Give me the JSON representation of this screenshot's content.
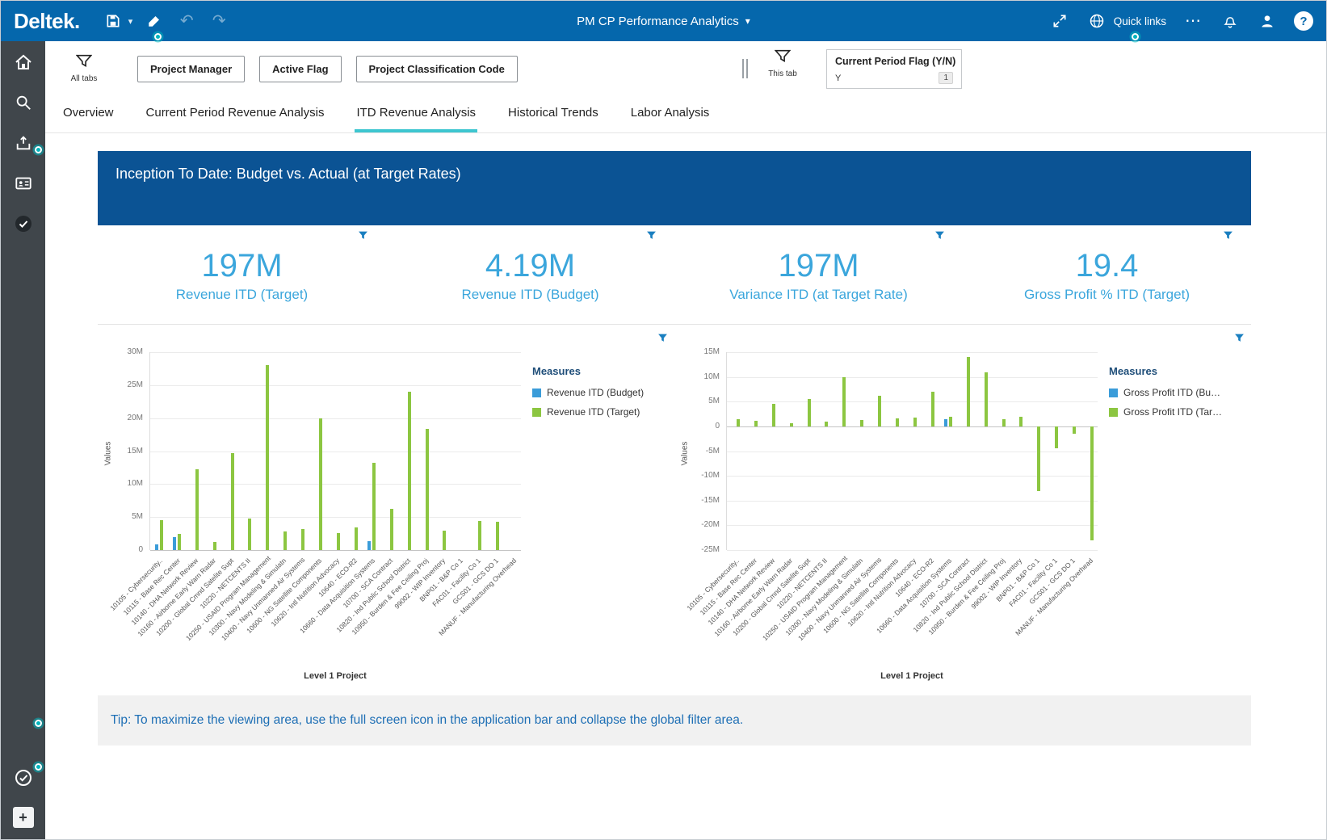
{
  "topbar": {
    "brand": "Deltek",
    "title": "PM CP Performance Analytics",
    "quick_links_label": "Quick links"
  },
  "icons": {
    "chevron_down": "▾",
    "undo": "↶",
    "redo": "↷",
    "ellipsis": "⋯",
    "help": "?",
    "plus": "+"
  },
  "filter_bar": {
    "all_tabs_label": "All tabs",
    "this_tab_label": "This tab",
    "filter_buttons": [
      {
        "label": "Project Manager"
      },
      {
        "label": "Active Flag"
      },
      {
        "label": "Project Classification Code"
      }
    ],
    "current_period_filter": {
      "title": "Current Period Flag (Y/N)",
      "value": "Y",
      "count": "1"
    }
  },
  "tabs": [
    {
      "label": "Overview",
      "active": false
    },
    {
      "label": "Current Period Revenue Analysis",
      "active": false
    },
    {
      "label": "ITD Revenue Analysis",
      "active": true
    },
    {
      "label": "Historical Trends",
      "active": false
    },
    {
      "label": "Labor Analysis",
      "active": false
    }
  ],
  "banner": {
    "title": "Inception To Date:  Budget vs. Actual (at Target Rates)"
  },
  "kpis": [
    {
      "value": "197M",
      "label": "Revenue ITD (Target)"
    },
    {
      "value": "4.19M",
      "label": "Revenue ITD (Budget)"
    },
    {
      "value": "197M",
      "label": "Variance ITD (at Target Rate)"
    },
    {
      "value": "19.4",
      "label": "Gross Profit % ITD (Target)"
    }
  ],
  "tip": {
    "text": "Tip:  To maximize the viewing area, use the full screen icon in the application bar and collapse the global filter area."
  },
  "colors": {
    "topbar_blue": "#0567AC",
    "banner_blue": "#0B5394",
    "kpi_blue": "#3BA6DC",
    "accent_teal": "#3EC6D0",
    "coachmark_teal": "#00B5BE",
    "bar_blue": "#3B9CD9",
    "bar_green": "#8CC641"
  },
  "chart_data": [
    {
      "type": "bar",
      "title": "",
      "xlabel": "Level 1 Project",
      "ylabel": "Values",
      "ylim": [
        0,
        30
      ],
      "yticks": [
        30,
        25,
        20,
        15,
        10,
        5,
        0
      ],
      "unit": "M",
      "grid": true,
      "legend_title": "Measures",
      "legend_position": "right",
      "categories": [
        "10105 - Cybersecurity..",
        "10115 - Base Rec Center",
        "10140 - DHA Network Review",
        "10160 - Airborne Early Warn Radar",
        "10200 - Global Cmnd Satelite Supt",
        "10220 - NETCENTS II",
        "10250 - USAID Program Management",
        "10300 - Navy Modeling & Simulatn",
        "10400 - Navy Unmanned Air Systems",
        "10600 - NG Satellite Components",
        "10620 - Intl Nutrition Advocacy",
        "10640 - ECO-R2",
        "10660 - Data Acquisition Systems",
        "10700 - SCA Contract",
        "10820 - Ind Public School District",
        "10950 - Burden & Fee Ceiling Proj",
        "99002 - WIP Inventory",
        "BNP01 - B&P Co 1",
        "FAC01 - Facility Co 1",
        "GCS01 - GCS DO 1",
        "MANUF - Manufacturing Overhead"
      ],
      "series": [
        {
          "name": "Revenue ITD (Budget)",
          "color": "#3B9CD9",
          "values": [
            0.9,
            2.0,
            0,
            0,
            0,
            0,
            0,
            0,
            0,
            0,
            0,
            0,
            1.3,
            0,
            0,
            0,
            0,
            0,
            0,
            0,
            0
          ]
        },
        {
          "name": "Revenue ITD (Target)",
          "color": "#8CC641",
          "values": [
            4.5,
            2.5,
            12.3,
            1.2,
            14.7,
            4.8,
            28.0,
            2.8,
            3.2,
            20.0,
            2.6,
            3.4,
            13.2,
            6.3,
            24.0,
            18.4,
            3.0,
            0,
            4.4,
            4.3,
            0
          ]
        }
      ]
    },
    {
      "type": "bar",
      "title": "",
      "xlabel": "Level 1 Project",
      "ylabel": "Values",
      "ylim": [
        -25,
        15
      ],
      "yticks": [
        15,
        10,
        5,
        0,
        -5,
        -10,
        -15,
        -20,
        -25
      ],
      "unit": "M",
      "grid": true,
      "legend_title": "Measures",
      "legend_position": "right",
      "categories": [
        "10105 - Cybersecurity..",
        "10115 - Base Rec Center",
        "10140 - DHA Network Review",
        "10160 - Airborne Early Warn Radar",
        "10200 - Global Cmnd Satelite Supt",
        "10220 - NETCENTS II",
        "10250 - USAID Program Management",
        "10300 - Navy Modeling & Simulatn",
        "10400 - Navy Unmanned Air Systems",
        "10600 - NG Satellite Components",
        "10620 - Intl Nutrition Advocacy",
        "10640 - ECO-R2",
        "10660 - Data Acquisition Systems",
        "10700 - SCA Contract",
        "10820 - Ind Public School District",
        "10950 - Burden & Fee Ceiling Proj",
        "99002 - WIP Inventory",
        "BNP01 - B&P Co 1",
        "FAC01 - Facility Co 1",
        "GCS01 - GCS DO 1",
        "MANUF - Manufacturing Overhead"
      ],
      "series": [
        {
          "name": "Gross Profit ITD (Bu…",
          "color": "#3B9CD9",
          "values": [
            0,
            0,
            0,
            0,
            0,
            0,
            0,
            0,
            0,
            0,
            0,
            0,
            1.5,
            0,
            0,
            0,
            0,
            0,
            0,
            0,
            0
          ]
        },
        {
          "name": "Gross Profit ITD (Tar…",
          "color": "#8CC641",
          "values": [
            1.5,
            1.2,
            4.5,
            0.6,
            5.5,
            1.0,
            10.0,
            1.3,
            6.2,
            1.6,
            1.8,
            7.0,
            1.9,
            14.0,
            11.0,
            1.5,
            2.0,
            -13.0,
            -4.5,
            -1.5,
            -23.0
          ]
        }
      ]
    }
  ]
}
